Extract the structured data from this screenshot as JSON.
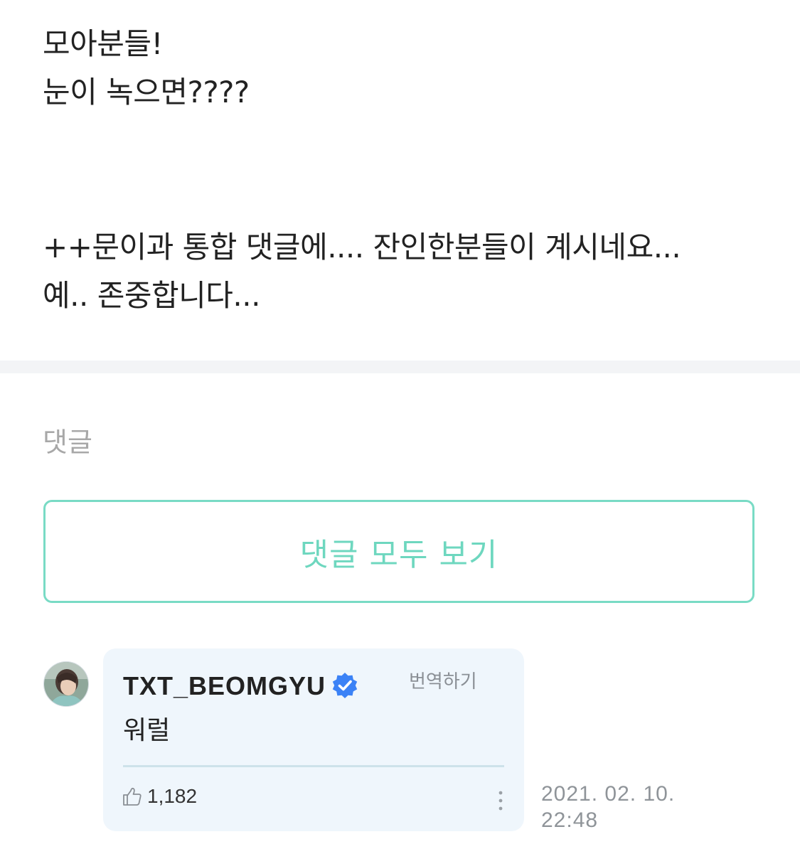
{
  "post": {
    "lines": [
      "모아분들!",
      "눈이 녹으면????",
      "++문이과 통합 댓글에.... 잔인한분들이 계시네요...",
      "예.. 존중합니다..."
    ]
  },
  "comments": {
    "heading": "댓글",
    "view_all_label": "댓글 모두 보기"
  },
  "comment": {
    "author": "TXT_BEOMGYU",
    "translate_label": "번역하기",
    "text": "워럴",
    "likes": "1,182",
    "date": "2021. 02. 10.",
    "time": "22:48"
  },
  "colors": {
    "accent": "#6ed7bf",
    "verified": "#3b82f6",
    "card_background": "#eff6fc"
  },
  "icons": {
    "verified": "verified-badge-icon",
    "like": "thumbs-up-icon",
    "more": "more-vertical-icon"
  }
}
